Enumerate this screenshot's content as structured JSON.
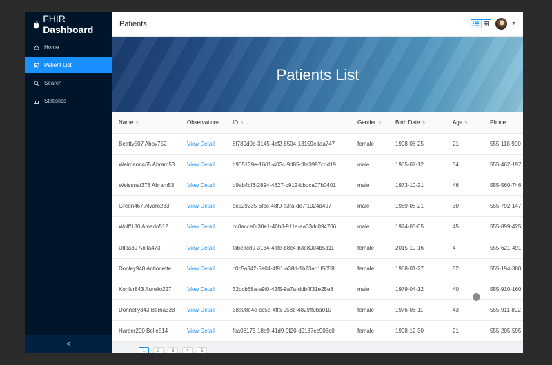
{
  "sidebar": {
    "brand": {
      "prefix": "FHIR",
      "strong": "Dashboard"
    },
    "items": [
      {
        "label": "Home",
        "icon": "home-icon"
      },
      {
        "label": "Patient List",
        "icon": "team-icon",
        "active": true
      },
      {
        "label": "Search",
        "icon": "search-icon"
      },
      {
        "label": "Statistics",
        "icon": "bar-chart-icon"
      }
    ],
    "collapse_glyph": "<"
  },
  "header": {
    "title": "Patients"
  },
  "banner": {
    "title": "Patients List"
  },
  "table": {
    "columns": [
      "Name",
      "Observations",
      "ID",
      "Gender",
      "Birth Date",
      "Age",
      "Phone"
    ],
    "rows": [
      [
        "Beatty507 Abby752",
        "View Detail",
        "8f789d0b-3145-4cf2-8504-13159edaa747",
        "female",
        "1998-08-25",
        "21",
        "555-118-900"
      ],
      [
        "Weimann465 Abram53",
        "View Detail",
        "b905139e-1601-403c-9d85-f8e3997cdd19",
        "male",
        "1965-07-12",
        "54",
        "555-462-197"
      ],
      [
        "Weissnat378 Abram53",
        "View Detail",
        "d9eb4cf6-2894-4627-b912-bbdca07b0401",
        "male",
        "1973-10-21",
        "46",
        "555-560-746"
      ],
      [
        "Green467 Alvaro283",
        "View Detail",
        "ac529235-6fbc-48f0-a3fa-de7f1924d497",
        "male",
        "1989-08-21",
        "30",
        "555-792-147"
      ],
      [
        "Wolff180 Amado512",
        "View Detail",
        "cc0acce0-30e1-40b8-911a-aa33dc094706",
        "male",
        "1974-05-05",
        "45",
        "555-899-425"
      ],
      [
        "Ulloa39 Anita473",
        "View Detail",
        "fabeac89-3134-4afe-b8c4-b3e8004b5d11",
        "female",
        "2015-10-16",
        "4",
        "555-621-491"
      ],
      [
        "Dooley940 Antionette...",
        "View Detail",
        "c0c5a342-5a04-4f91-a38d-1b23ad1f5058",
        "female",
        "1968-01-27",
        "52",
        "555-194-380"
      ],
      [
        "Kohler843 Aurelio227",
        "View Detail",
        "32bcb68a-a9f0-42f5-9a7a-ddb4f31e25e8",
        "male",
        "1979-04-12",
        "40",
        "555-910-160"
      ],
      [
        "Donnelly343 Berna338",
        "View Detail",
        "58a08e4e-cc5b-4ffa-958b-4829ff0ba010",
        "female",
        "1976-06-11",
        "43",
        "555-911-892"
      ],
      [
        "Harber290 Belle514",
        "View Detail",
        "fea08173-18e9-41d9-9f20-d9187ec906c0",
        "female",
        "1998-12-30",
        "21",
        "555-205-595"
      ]
    ]
  },
  "pager": {
    "pages": [
      "1",
      "2",
      "3",
      "4",
      "5"
    ],
    "current": "1"
  }
}
